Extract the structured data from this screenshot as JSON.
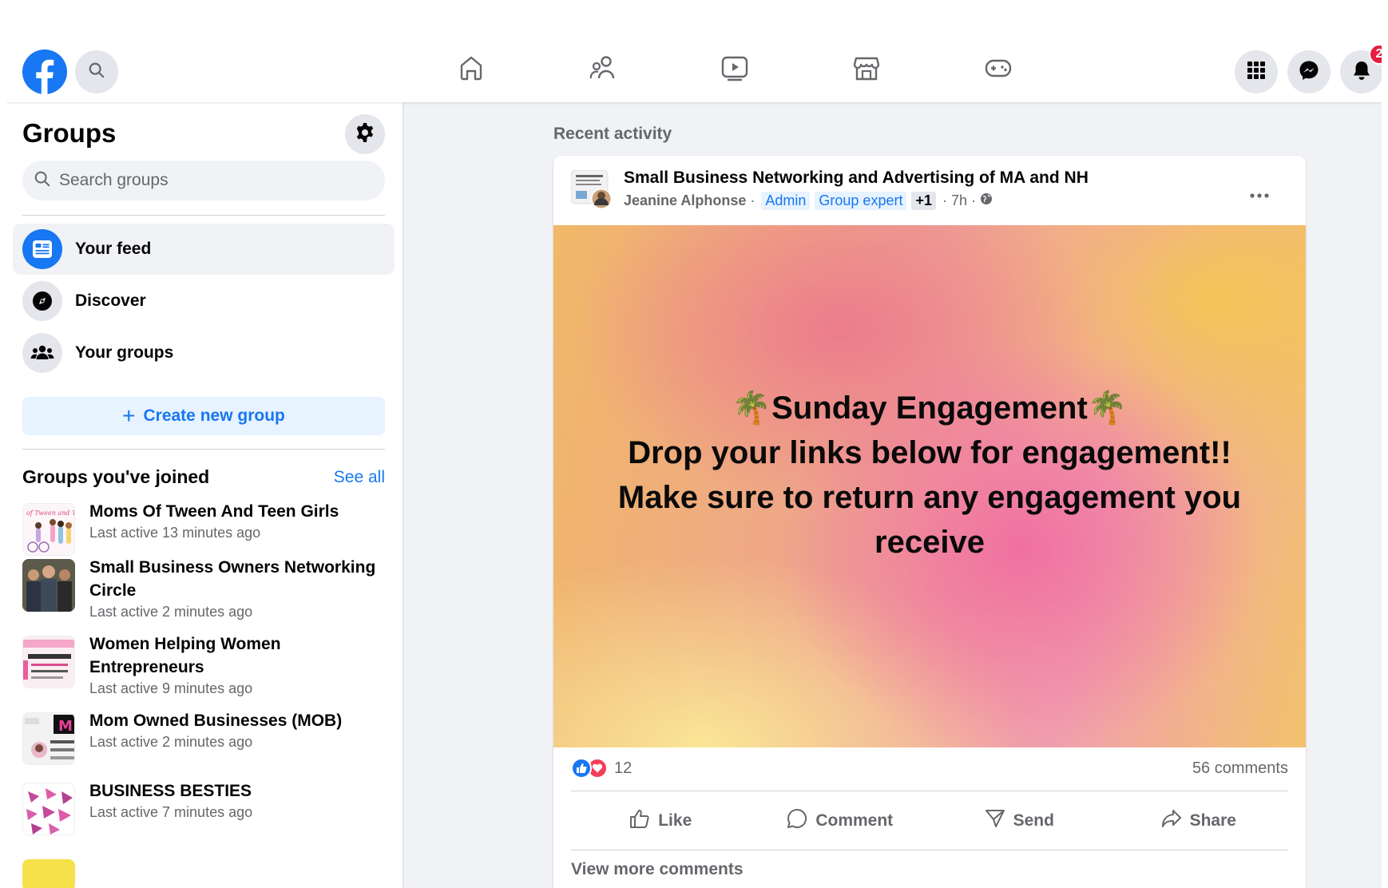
{
  "topbar": {
    "logo": "facebook-logo",
    "search_icon": "search-icon",
    "nav_icons": [
      "home-icon",
      "friends-icon",
      "watch-icon",
      "marketplace-icon",
      "gaming-icon"
    ],
    "right_icons": [
      "menu-grid-icon",
      "messenger-icon",
      "bell-icon"
    ],
    "notification_count": "2"
  },
  "sidebar": {
    "title": "Groups",
    "search_placeholder": "Search groups",
    "items": [
      {
        "label": "Your feed",
        "icon": "feed-icon",
        "active": true
      },
      {
        "label": "Discover",
        "icon": "compass-icon",
        "active": false
      },
      {
        "label": "Your groups",
        "icon": "groups-icon",
        "active": false
      }
    ],
    "create_label": "Create new group",
    "joined_title": "Groups you've joined",
    "see_all": "See all",
    "groups": [
      {
        "name": "Moms Of Tween And Teen Girls",
        "activity": "Last active 13 minutes ago"
      },
      {
        "name": "Small Business Owners Networking Circle",
        "activity": "Last active 2 minutes ago"
      },
      {
        "name": "Women Helping Women Entrepreneurs",
        "activity": "Last active 9 minutes ago"
      },
      {
        "name": "Mom Owned Businesses (MOB)",
        "activity": "Last active 2 minutes ago"
      },
      {
        "name": "BUSINESS BESTIES",
        "activity": "Last active 7 minutes ago"
      }
    ]
  },
  "main": {
    "section_title": "Recent activity",
    "post": {
      "group_name": "Small Business Networking and Advertising of MA and NH",
      "author": "Jeanine Alphonse",
      "badges": [
        "Admin",
        "Group expert"
      ],
      "extra_badge": "+1",
      "time": "7h",
      "audience_icon": "globe-icon",
      "text": {
        "line1": "🌴Sunday Engagement🌴",
        "line2": "Drop your links below for engagement!!",
        "line3": "Make sure to return any engagement you",
        "line4": "receive"
      },
      "reaction_icons": [
        "like-reaction-icon",
        "love-reaction-icon"
      ],
      "reaction_count": "12",
      "comment_count": "56 comments",
      "actions": {
        "like": "Like",
        "comment": "Comment",
        "send": "Send",
        "share": "Share"
      },
      "view_more": "View more comments"
    }
  },
  "colors": {
    "brand_blue": "#1877f2",
    "background": "#f0f2f5",
    "secondary_text": "#65676b",
    "badge_red": "#e41e3f"
  }
}
